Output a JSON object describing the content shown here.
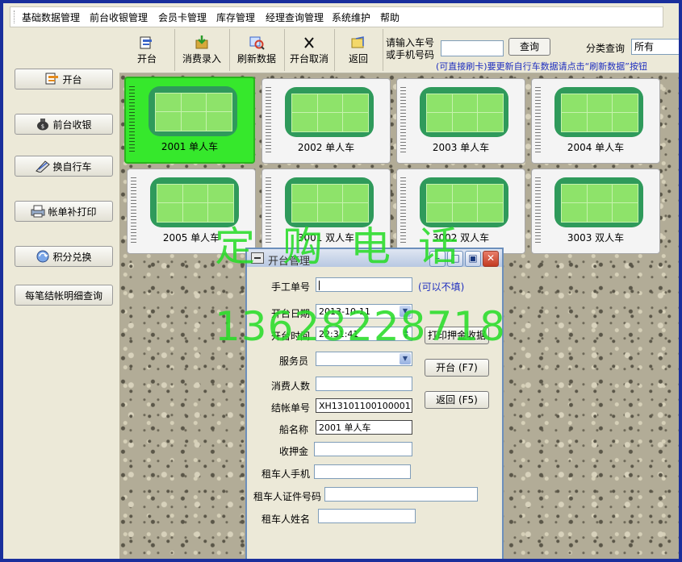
{
  "menu": [
    "基础数据管理",
    "前台收银管理",
    "会员卡管理",
    "库存管理",
    "经理查询管理",
    "系统维护",
    "帮助"
  ],
  "toolbar": {
    "buttons": [
      {
        "label": "开台",
        "icon": "open-table-icon"
      },
      {
        "label": "消费录入",
        "icon": "consume-entry-icon"
      },
      {
        "label": "刷新数据",
        "icon": "refresh-icon"
      },
      {
        "label": "开台取消",
        "icon": "cancel-x-icon"
      },
      {
        "label": "返回",
        "icon": "return-icon"
      }
    ],
    "search_label_line1": "请输入车号",
    "search_label_line2": "或手机号码",
    "search_value": "",
    "query_label": "查询",
    "category_label": "分类查询",
    "category_value": "所有",
    "hint": "(可直接刷卡)要更新自行车数据请点击“刷新数据”按钮"
  },
  "sidebar": [
    {
      "label": "开台",
      "icon": "open-table-icon"
    },
    {
      "label": "前台收银",
      "icon": "money-bag-icon"
    },
    {
      "label": "换自行车",
      "icon": "swap-bike-icon"
    },
    {
      "label": "帐单补打印",
      "icon": "printer-icon"
    },
    {
      "label": "积分兑换",
      "icon": "points-exchange-icon"
    },
    {
      "label": "每笔结帐明细查询",
      "icon": ""
    }
  ],
  "tiles": [
    {
      "label": "2001 单人车",
      "selected": true
    },
    {
      "label": "2002 单人车",
      "selected": false
    },
    {
      "label": "2003 单人车",
      "selected": false
    },
    {
      "label": "2004 单人车",
      "selected": false
    },
    {
      "label": "2005 单人车",
      "selected": false
    },
    {
      "label": "3001 双人车",
      "selected": false
    },
    {
      "label": "3002 双人车",
      "selected": false
    },
    {
      "label": "3003 双人车",
      "selected": false
    }
  ],
  "watermark": {
    "line1": "定购电话",
    "line2": "13628228718"
  },
  "dialog": {
    "title": "开台管理",
    "manual_no_label": "手工单号",
    "manual_no_value": "",
    "manual_no_note": "(可以不填)",
    "date_label": "开台日期",
    "date_value": "2013-10-11",
    "time_label": "开台时间",
    "time_value": "22:31:41",
    "waiter_label": "服务员",
    "waiter_value": "",
    "people_label": "消费人数",
    "people_value": "",
    "bill_no_label": "结帐单号",
    "bill_no_value": "XH13101100100001",
    "boat_label": "船名称",
    "boat_value": "2001 单人车",
    "deposit_label": "收押金",
    "deposit_value": "",
    "phone_label": "租车人手机",
    "phone_value": "",
    "idcard_label": "租车人证件号码",
    "idcard_value": "",
    "name_label": "租车人姓名",
    "name_value": "",
    "print_btn": "打印押金收据",
    "open_btn": "开台 (F7)",
    "back_btn": "返回 (F5)"
  }
}
